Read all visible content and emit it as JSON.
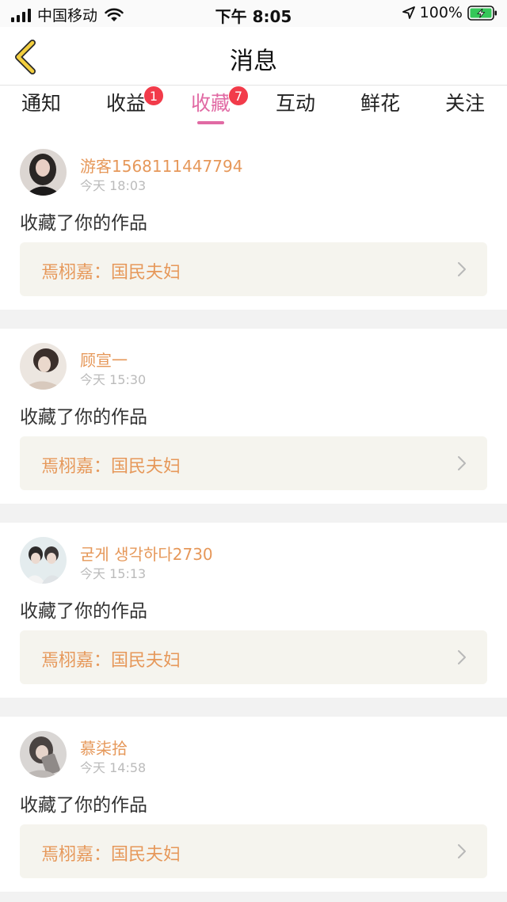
{
  "status_bar": {
    "carrier": "中国移动",
    "time": "下午 8:05",
    "battery": "100%"
  },
  "nav": {
    "title": "消息",
    "back_icon": "chevron-left-icon"
  },
  "tabs": [
    {
      "label": "通知",
      "badge": ""
    },
    {
      "label": "收益",
      "badge": "1"
    },
    {
      "label": "收藏",
      "badge": "7"
    },
    {
      "label": "互动",
      "badge": ""
    },
    {
      "label": "鲜花",
      "badge": ""
    },
    {
      "label": "关注",
      "badge": ""
    }
  ],
  "active_tab": "收藏",
  "colors": {
    "accent": "#e16aa4",
    "username": "#e6985a",
    "badge": "#f23b4a"
  },
  "messages": [
    {
      "username": "游客1568111447794",
      "time": "今天 18:03",
      "action": "收藏了你的作品",
      "work": "焉栩嘉：国民夫妇"
    },
    {
      "username": "顾宣一",
      "time": "今天 15:30",
      "action": "收藏了你的作品",
      "work": "焉栩嘉：国民夫妇"
    },
    {
      "username": "굳게 생각하다2730",
      "time": "今天 15:13",
      "action": "收藏了你的作品",
      "work": "焉栩嘉：国民夫妇"
    },
    {
      "username": "慕柒拾",
      "time": "今天 14:58",
      "action": "收藏了你的作品",
      "work": "焉栩嘉：国民夫妇"
    }
  ]
}
